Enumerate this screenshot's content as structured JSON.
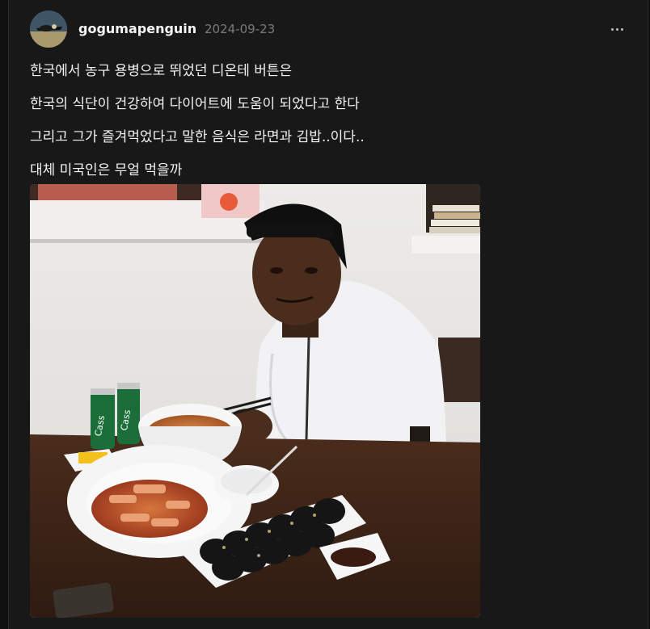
{
  "post": {
    "username": "gogumapenguin",
    "date": "2024-09-23",
    "lines": [
      "한국에서 농구 용병으로 뛰었던 디온테 버튼은",
      "한국의 식단이 건강하여 다이어트에 도움이 되었다고 한다",
      "그리고 그가 즐겨먹었다고 말한 음식은 라면과 김밥..이다..",
      "대체 미국인은 무얼 먹을까"
    ],
    "photo_text": {
      "can_label_1": "Cass",
      "can_label_2": "Cass"
    }
  },
  "icons": {
    "more": "more-horizontal-icon",
    "avatar": "penguin-avatar"
  }
}
